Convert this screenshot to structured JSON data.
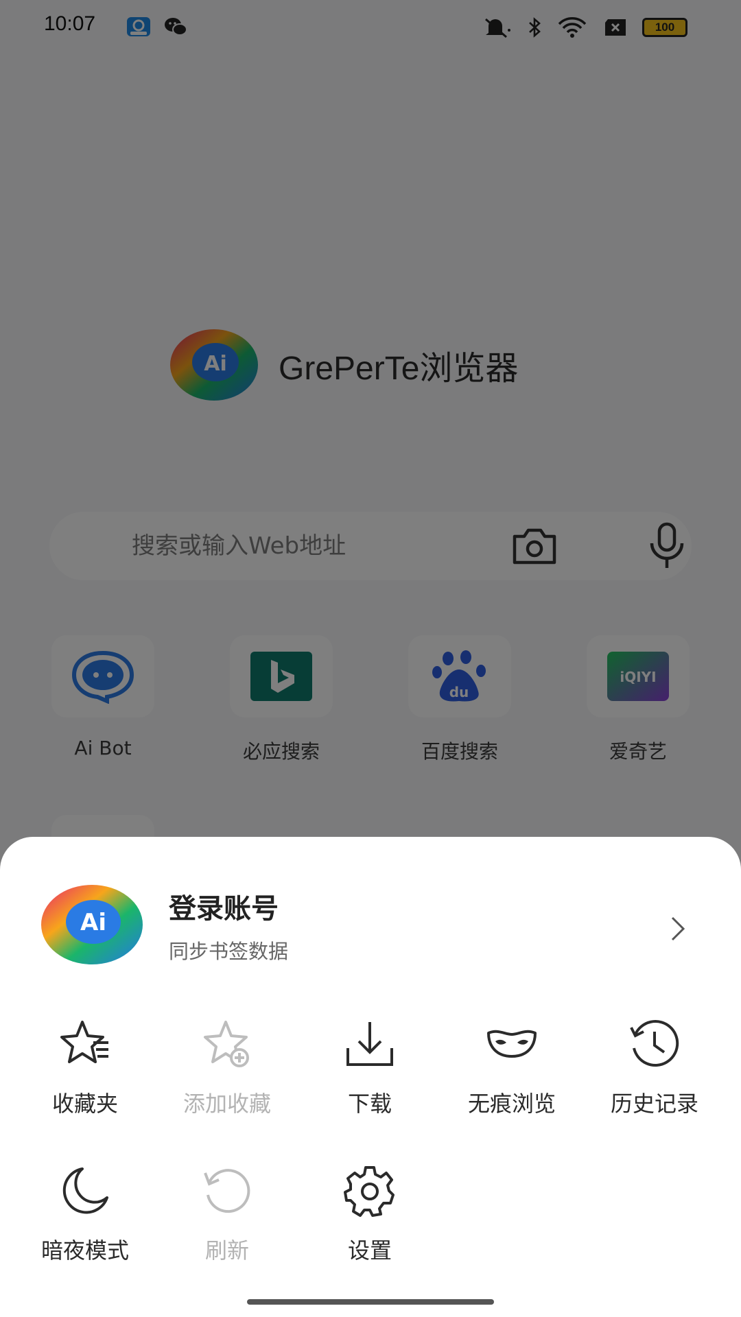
{
  "status_bar": {
    "time": "10:07",
    "battery": "100",
    "icons": [
      "app-notification-icon",
      "wechat-icon",
      "mute-icon",
      "bluetooth-icon",
      "wifi-icon",
      "sim-off-icon",
      "battery-icon"
    ]
  },
  "home": {
    "brand_title": "GrePerTe浏览器",
    "search": {
      "placeholder": "搜索或输入Web地址",
      "camera_icon": "camera-icon",
      "mic_icon": "mic-icon"
    },
    "shortcuts": [
      {
        "label": "Ai Bot",
        "icon": "ai-bot-icon"
      },
      {
        "label": "必应搜索",
        "icon": "bing-icon"
      },
      {
        "label": "百度搜索",
        "icon": "baidu-icon"
      },
      {
        "label": "爱奇艺",
        "icon": "iqiyi-icon",
        "icon_text": "iQIYI"
      }
    ]
  },
  "sheet": {
    "account": {
      "title": "登录账号",
      "subtitle": "同步书签数据",
      "avatar_text": "Ai"
    },
    "menu": [
      {
        "label": "收藏夹",
        "icon": "favorites-icon",
        "enabled": true
      },
      {
        "label": "添加收藏",
        "icon": "add-favorite-icon",
        "enabled": false
      },
      {
        "label": "下载",
        "icon": "download-icon",
        "enabled": true
      },
      {
        "label": "无痕浏览",
        "icon": "incognito-mask-icon",
        "enabled": true
      },
      {
        "label": "历史记录",
        "icon": "history-icon",
        "enabled": true
      },
      {
        "label": "暗夜模式",
        "icon": "moon-icon",
        "enabled": true
      },
      {
        "label": "刷新",
        "icon": "refresh-icon",
        "enabled": false
      },
      {
        "label": "设置",
        "icon": "settings-gear-icon",
        "enabled": true
      }
    ]
  },
  "colors": {
    "scrim": "#000000",
    "sheet_bg": "#ffffff",
    "disabled_text": "#b3b3b3",
    "bing_green": "#0f7b6c",
    "baidu_blue": "#2f5fe0",
    "iqiyi_green": "#1fbe4a"
  }
}
